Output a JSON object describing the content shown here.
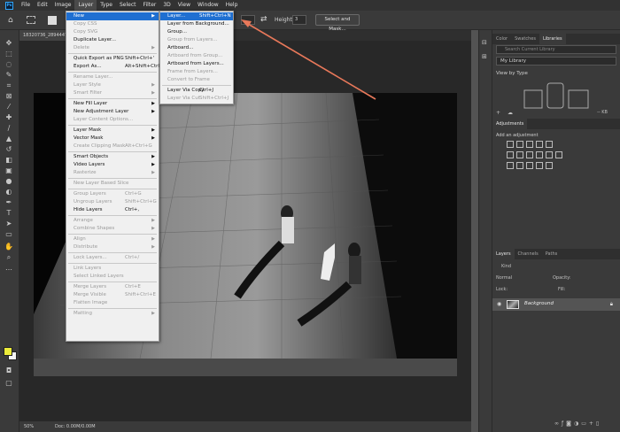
{
  "menubar": {
    "logo": "Ps",
    "items": [
      "File",
      "Edit",
      "Image",
      "Layer",
      "Type",
      "Select",
      "Filter",
      "3D",
      "View",
      "Window",
      "Help"
    ]
  },
  "options": {
    "height_label": "Height:",
    "height_value": "3",
    "select_mask": "Select and Mask..."
  },
  "document": {
    "tab": "18320736_2894447...",
    "zoom": "50%",
    "doc_info": "Doc: 0.00M/0.00M"
  },
  "layer_menu": [
    {
      "label": "New",
      "shortcut": "",
      "arrow": true,
      "disabled": false,
      "highlight": true
    },
    {
      "label": "Copy CSS",
      "shortcut": "",
      "arrow": false,
      "disabled": true
    },
    {
      "label": "Copy SVG",
      "shortcut": "",
      "arrow": false,
      "disabled": true
    },
    {
      "label": "Duplicate Layer...",
      "shortcut": "",
      "arrow": false,
      "disabled": false
    },
    {
      "label": "Delete",
      "shortcut": "",
      "arrow": true,
      "disabled": true,
      "sep_after": true
    },
    {
      "label": "Quick Export as PNG",
      "shortcut": "Shift+Ctrl+'",
      "arrow": false,
      "disabled": false
    },
    {
      "label": "Export As...",
      "shortcut": "Alt+Shift+Ctrl+'",
      "arrow": false,
      "disabled": false,
      "sep_after": true
    },
    {
      "label": "Rename Layer...",
      "shortcut": "",
      "arrow": false,
      "disabled": true
    },
    {
      "label": "Layer Style",
      "shortcut": "",
      "arrow": true,
      "disabled": true
    },
    {
      "label": "Smart Filter",
      "shortcut": "",
      "arrow": true,
      "disabled": true,
      "sep_after": true
    },
    {
      "label": "New Fill Layer",
      "shortcut": "",
      "arrow": true,
      "disabled": false
    },
    {
      "label": "New Adjustment Layer",
      "shortcut": "",
      "arrow": true,
      "disabled": false
    },
    {
      "label": "Layer Content Options...",
      "shortcut": "",
      "arrow": false,
      "disabled": true,
      "sep_after": true
    },
    {
      "label": "Layer Mask",
      "shortcut": "",
      "arrow": true,
      "disabled": false
    },
    {
      "label": "Vector Mask",
      "shortcut": "",
      "arrow": true,
      "disabled": false
    },
    {
      "label": "Create Clipping Mask",
      "shortcut": "Alt+Ctrl+G",
      "arrow": false,
      "disabled": true,
      "sep_after": true
    },
    {
      "label": "Smart Objects",
      "shortcut": "",
      "arrow": true,
      "disabled": false
    },
    {
      "label": "Video Layers",
      "shortcut": "",
      "arrow": true,
      "disabled": false
    },
    {
      "label": "Rasterize",
      "shortcut": "",
      "arrow": true,
      "disabled": true,
      "sep_after": true
    },
    {
      "label": "New Layer Based Slice",
      "shortcut": "",
      "arrow": false,
      "disabled": true,
      "sep_after": true
    },
    {
      "label": "Group Layers",
      "shortcut": "Ctrl+G",
      "arrow": false,
      "disabled": true
    },
    {
      "label": "Ungroup Layers",
      "shortcut": "Shift+Ctrl+G",
      "arrow": false,
      "disabled": true
    },
    {
      "label": "Hide Layers",
      "shortcut": "Ctrl+,",
      "arrow": false,
      "disabled": false,
      "sep_after": true
    },
    {
      "label": "Arrange",
      "shortcut": "",
      "arrow": true,
      "disabled": true
    },
    {
      "label": "Combine Shapes",
      "shortcut": "",
      "arrow": true,
      "disabled": true,
      "sep_after": true
    },
    {
      "label": "Align",
      "shortcut": "",
      "arrow": true,
      "disabled": true
    },
    {
      "label": "Distribute",
      "shortcut": "",
      "arrow": true,
      "disabled": true,
      "sep_after": true
    },
    {
      "label": "Lock Layers...",
      "shortcut": "Ctrl+/",
      "arrow": false,
      "disabled": true,
      "sep_after": true
    },
    {
      "label": "Link Layers",
      "shortcut": "",
      "arrow": false,
      "disabled": true
    },
    {
      "label": "Select Linked Layers",
      "shortcut": "",
      "arrow": false,
      "disabled": true,
      "sep_after": true
    },
    {
      "label": "Merge Layers",
      "shortcut": "Ctrl+E",
      "arrow": false,
      "disabled": true
    },
    {
      "label": "Merge Visible",
      "shortcut": "Shift+Ctrl+E",
      "arrow": false,
      "disabled": true
    },
    {
      "label": "Flatten Image",
      "shortcut": "",
      "arrow": false,
      "disabled": true,
      "sep_after": true
    },
    {
      "label": "Matting",
      "shortcut": "",
      "arrow": true,
      "disabled": true
    }
  ],
  "new_submenu": [
    {
      "label": "Layer...",
      "shortcut": "Shift+Ctrl+N",
      "disabled": false,
      "highlight": true
    },
    {
      "label": "Layer from Background...",
      "shortcut": "",
      "disabled": false
    },
    {
      "label": "Group...",
      "shortcut": "",
      "disabled": false
    },
    {
      "label": "Group from Layers...",
      "shortcut": "",
      "disabled": true
    },
    {
      "label": "Artboard...",
      "shortcut": "",
      "disabled": false
    },
    {
      "label": "Artboard from Group...",
      "shortcut": "",
      "disabled": true
    },
    {
      "label": "Artboard from Layers...",
      "shortcut": "",
      "disabled": false
    },
    {
      "label": "Frame from Layers...",
      "shortcut": "",
      "disabled": true
    },
    {
      "label": "Convert to Frame",
      "shortcut": "",
      "disabled": true,
      "sep_after": true
    },
    {
      "label": "Layer Via Copy",
      "shortcut": "Ctrl+J",
      "disabled": false
    },
    {
      "label": "Layer Via Cut",
      "shortcut": "Shift+Ctrl+J",
      "disabled": true
    }
  ],
  "panels": {
    "top_tabs": [
      "Color",
      "Swatches",
      "Libraries"
    ],
    "search_placeholder": "Search Current Library",
    "library": "My Library",
    "view_by": "View by Type",
    "kb": "-- KB",
    "adjustments_tab": "Adjustments",
    "add_adjustment": "Add an adjustment",
    "layers_tabs": [
      "Layers",
      "Channels",
      "Paths"
    ],
    "kind": "Kind",
    "blend": "Normal",
    "opacity": "Opacity:",
    "lock": "Lock:",
    "fill": "Fill:",
    "layer_name": "Background"
  },
  "colors": {
    "accent": "#1f6fd1",
    "arrow": "#e8785a",
    "foreground": "#ecec3a"
  }
}
